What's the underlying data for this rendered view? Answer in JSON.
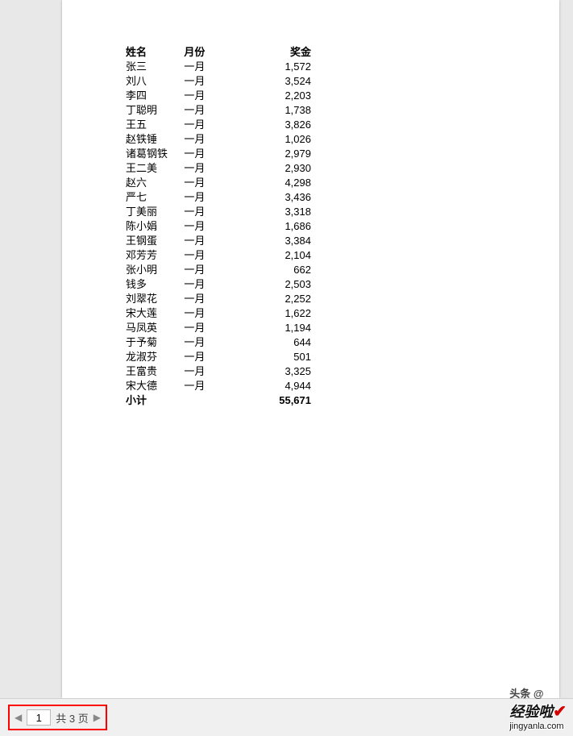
{
  "headers": {
    "name": "姓名",
    "month": "月份",
    "bonus": "奖金"
  },
  "rows": [
    {
      "name": "张三",
      "month": "一月",
      "bonus": "1,572"
    },
    {
      "name": "刘八",
      "month": "一月",
      "bonus": "3,524"
    },
    {
      "name": "李四",
      "month": "一月",
      "bonus": "2,203"
    },
    {
      "name": "丁聪明",
      "month": "一月",
      "bonus": "1,738"
    },
    {
      "name": "王五",
      "month": "一月",
      "bonus": "3,826"
    },
    {
      "name": "赵铁锤",
      "month": "一月",
      "bonus": "1,026"
    },
    {
      "name": "诸葛钢铁",
      "month": "一月",
      "bonus": "2,979"
    },
    {
      "name": "王二美",
      "month": "一月",
      "bonus": "2,930"
    },
    {
      "name": "赵六",
      "month": "一月",
      "bonus": "4,298"
    },
    {
      "name": "严七",
      "month": "一月",
      "bonus": "3,436"
    },
    {
      "name": "丁美丽",
      "month": "一月",
      "bonus": "3,318"
    },
    {
      "name": "陈小娟",
      "month": "一月",
      "bonus": "1,686"
    },
    {
      "name": "王钢蛋",
      "month": "一月",
      "bonus": "3,384"
    },
    {
      "name": "邓芳芳",
      "month": "一月",
      "bonus": "2,104"
    },
    {
      "name": "张小明",
      "month": "一月",
      "bonus": "662"
    },
    {
      "name": "钱多",
      "month": "一月",
      "bonus": "2,503"
    },
    {
      "name": "刘翠花",
      "month": "一月",
      "bonus": "2,252"
    },
    {
      "name": "宋大莲",
      "month": "一月",
      "bonus": "1,622"
    },
    {
      "name": "马凤英",
      "month": "一月",
      "bonus": "1,194"
    },
    {
      "name": "于予菊",
      "month": "一月",
      "bonus": "644"
    },
    {
      "name": "龙淑芬",
      "month": "一月",
      "bonus": "501"
    },
    {
      "name": "王富贵",
      "month": "一月",
      "bonus": "3,325"
    },
    {
      "name": "宋大德",
      "month": "一月",
      "bonus": "4,944"
    }
  ],
  "subtotal": {
    "label": "小计",
    "bonus": "55,671"
  },
  "pager": {
    "current": "1",
    "text_prefix": "共 ",
    "total": "3",
    "text_suffix": " 页"
  },
  "watermark": {
    "top": "头条 @",
    "brand": "经验啦",
    "check": "✔",
    "site": "jingyanla.com"
  }
}
